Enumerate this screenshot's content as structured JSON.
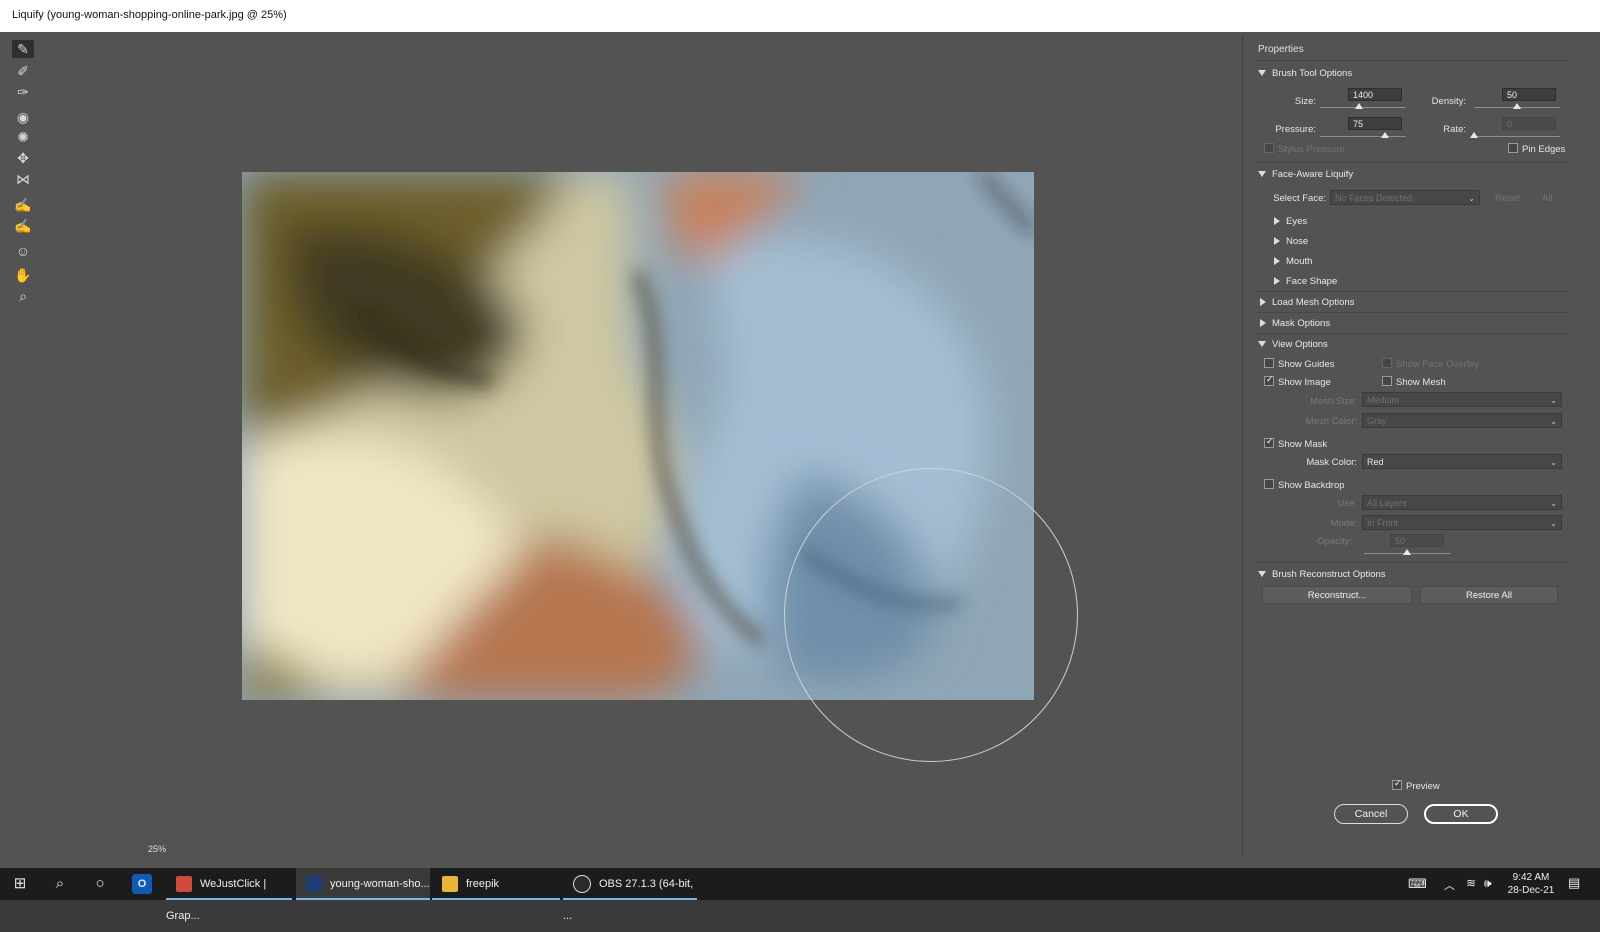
{
  "window": {
    "title": "Liquify (young-woman-shopping-online-park.jpg @ 25%)"
  },
  "tools": [
    {
      "name": "forward-warp-tool-icon",
      "glyph": "✎"
    },
    {
      "name": "reconstruct-tool-icon",
      "glyph": "✐"
    },
    {
      "name": "smooth-tool-icon",
      "glyph": "✑"
    },
    {
      "name": "twirl-clockwise-tool-icon",
      "glyph": "◉"
    },
    {
      "name": "pucker-tool-icon",
      "glyph": "✺"
    },
    {
      "name": "bloat-tool-icon",
      "glyph": "✥"
    },
    {
      "name": "push-left-tool-icon",
      "glyph": "⋈"
    },
    {
      "name": "freeze-mask-tool-icon",
      "glyph": "✍"
    },
    {
      "name": "thaw-mask-tool-icon",
      "glyph": "✍"
    },
    {
      "name": "face-tool-icon",
      "glyph": "☺"
    },
    {
      "name": "hand-tool-icon",
      "glyph": "✋"
    },
    {
      "name": "zoom-tool-icon",
      "glyph": "⌕"
    }
  ],
  "status": {
    "zoom": "25%"
  },
  "properties": {
    "title": "Properties",
    "brush_tool_options": {
      "header": "Brush Tool Options",
      "size_label": "Size:",
      "size_value": "1400",
      "size_level": 0.45,
      "density_label": "Density:",
      "density_value": "50",
      "density_level": 0.5,
      "pressure_label": "Pressure:",
      "pressure_value": "75",
      "pressure_level": 0.75,
      "rate_label": "Rate:",
      "rate_value": "0",
      "rate_level": 0.0,
      "stylus_pressure": "Stylus Pressure",
      "pin_edges": "Pin Edges"
    },
    "face_aware": {
      "header": "Face-Aware Liquify",
      "select_face_label": "Select Face:",
      "select_face_value": "No Faces Detected",
      "reset": "Reset",
      "all": "All",
      "eyes": "Eyes",
      "nose": "Nose",
      "mouth": "Mouth",
      "face_shape": "Face Shape"
    },
    "load_mesh": "Load Mesh Options",
    "mask_options": "Mask Options",
    "view_options": {
      "header": "View Options",
      "show_guides": "Show Guides",
      "show_face_overlay": "Show Face Overlay",
      "show_image": "Show Image",
      "show_mesh": "Show Mesh",
      "mesh_size_label": "Mesh Size:",
      "mesh_size_value": "Medium",
      "mesh_color_label": "Mesh Color:",
      "mesh_color_value": "Gray",
      "show_mask": "Show Mask",
      "mask_color_label": "Mask Color:",
      "mask_color_value": "Red",
      "show_backdrop": "Show Backdrop",
      "use_label": "Use:",
      "use_value": "All Layers",
      "mode_label": "Mode:",
      "mode_value": "In Front",
      "opacity_label": "Opacity:",
      "opacity_value": "50",
      "opacity_level": 0.5
    },
    "reconstruct": {
      "header": "Brush Reconstruct Options",
      "reconstruct_button": "Reconstruct...",
      "restore_all_button": "Restore All"
    },
    "preview": "Preview",
    "cancel": "Cancel",
    "ok": "OK"
  },
  "taskbar": {
    "apps": [
      {
        "label": "WeJustClick | Grap...",
        "color": "#d04a3a"
      },
      {
        "label": "young-woman-sho...",
        "color": "#1f3f74"
      },
      {
        "label": "freepik",
        "color": "#e8b53a"
      },
      {
        "label": "OBS 27.1.3 (64-bit, ...",
        "color": "#2a2a2a"
      }
    ],
    "time": "9:42 AM",
    "date": "28-Dec-21"
  }
}
